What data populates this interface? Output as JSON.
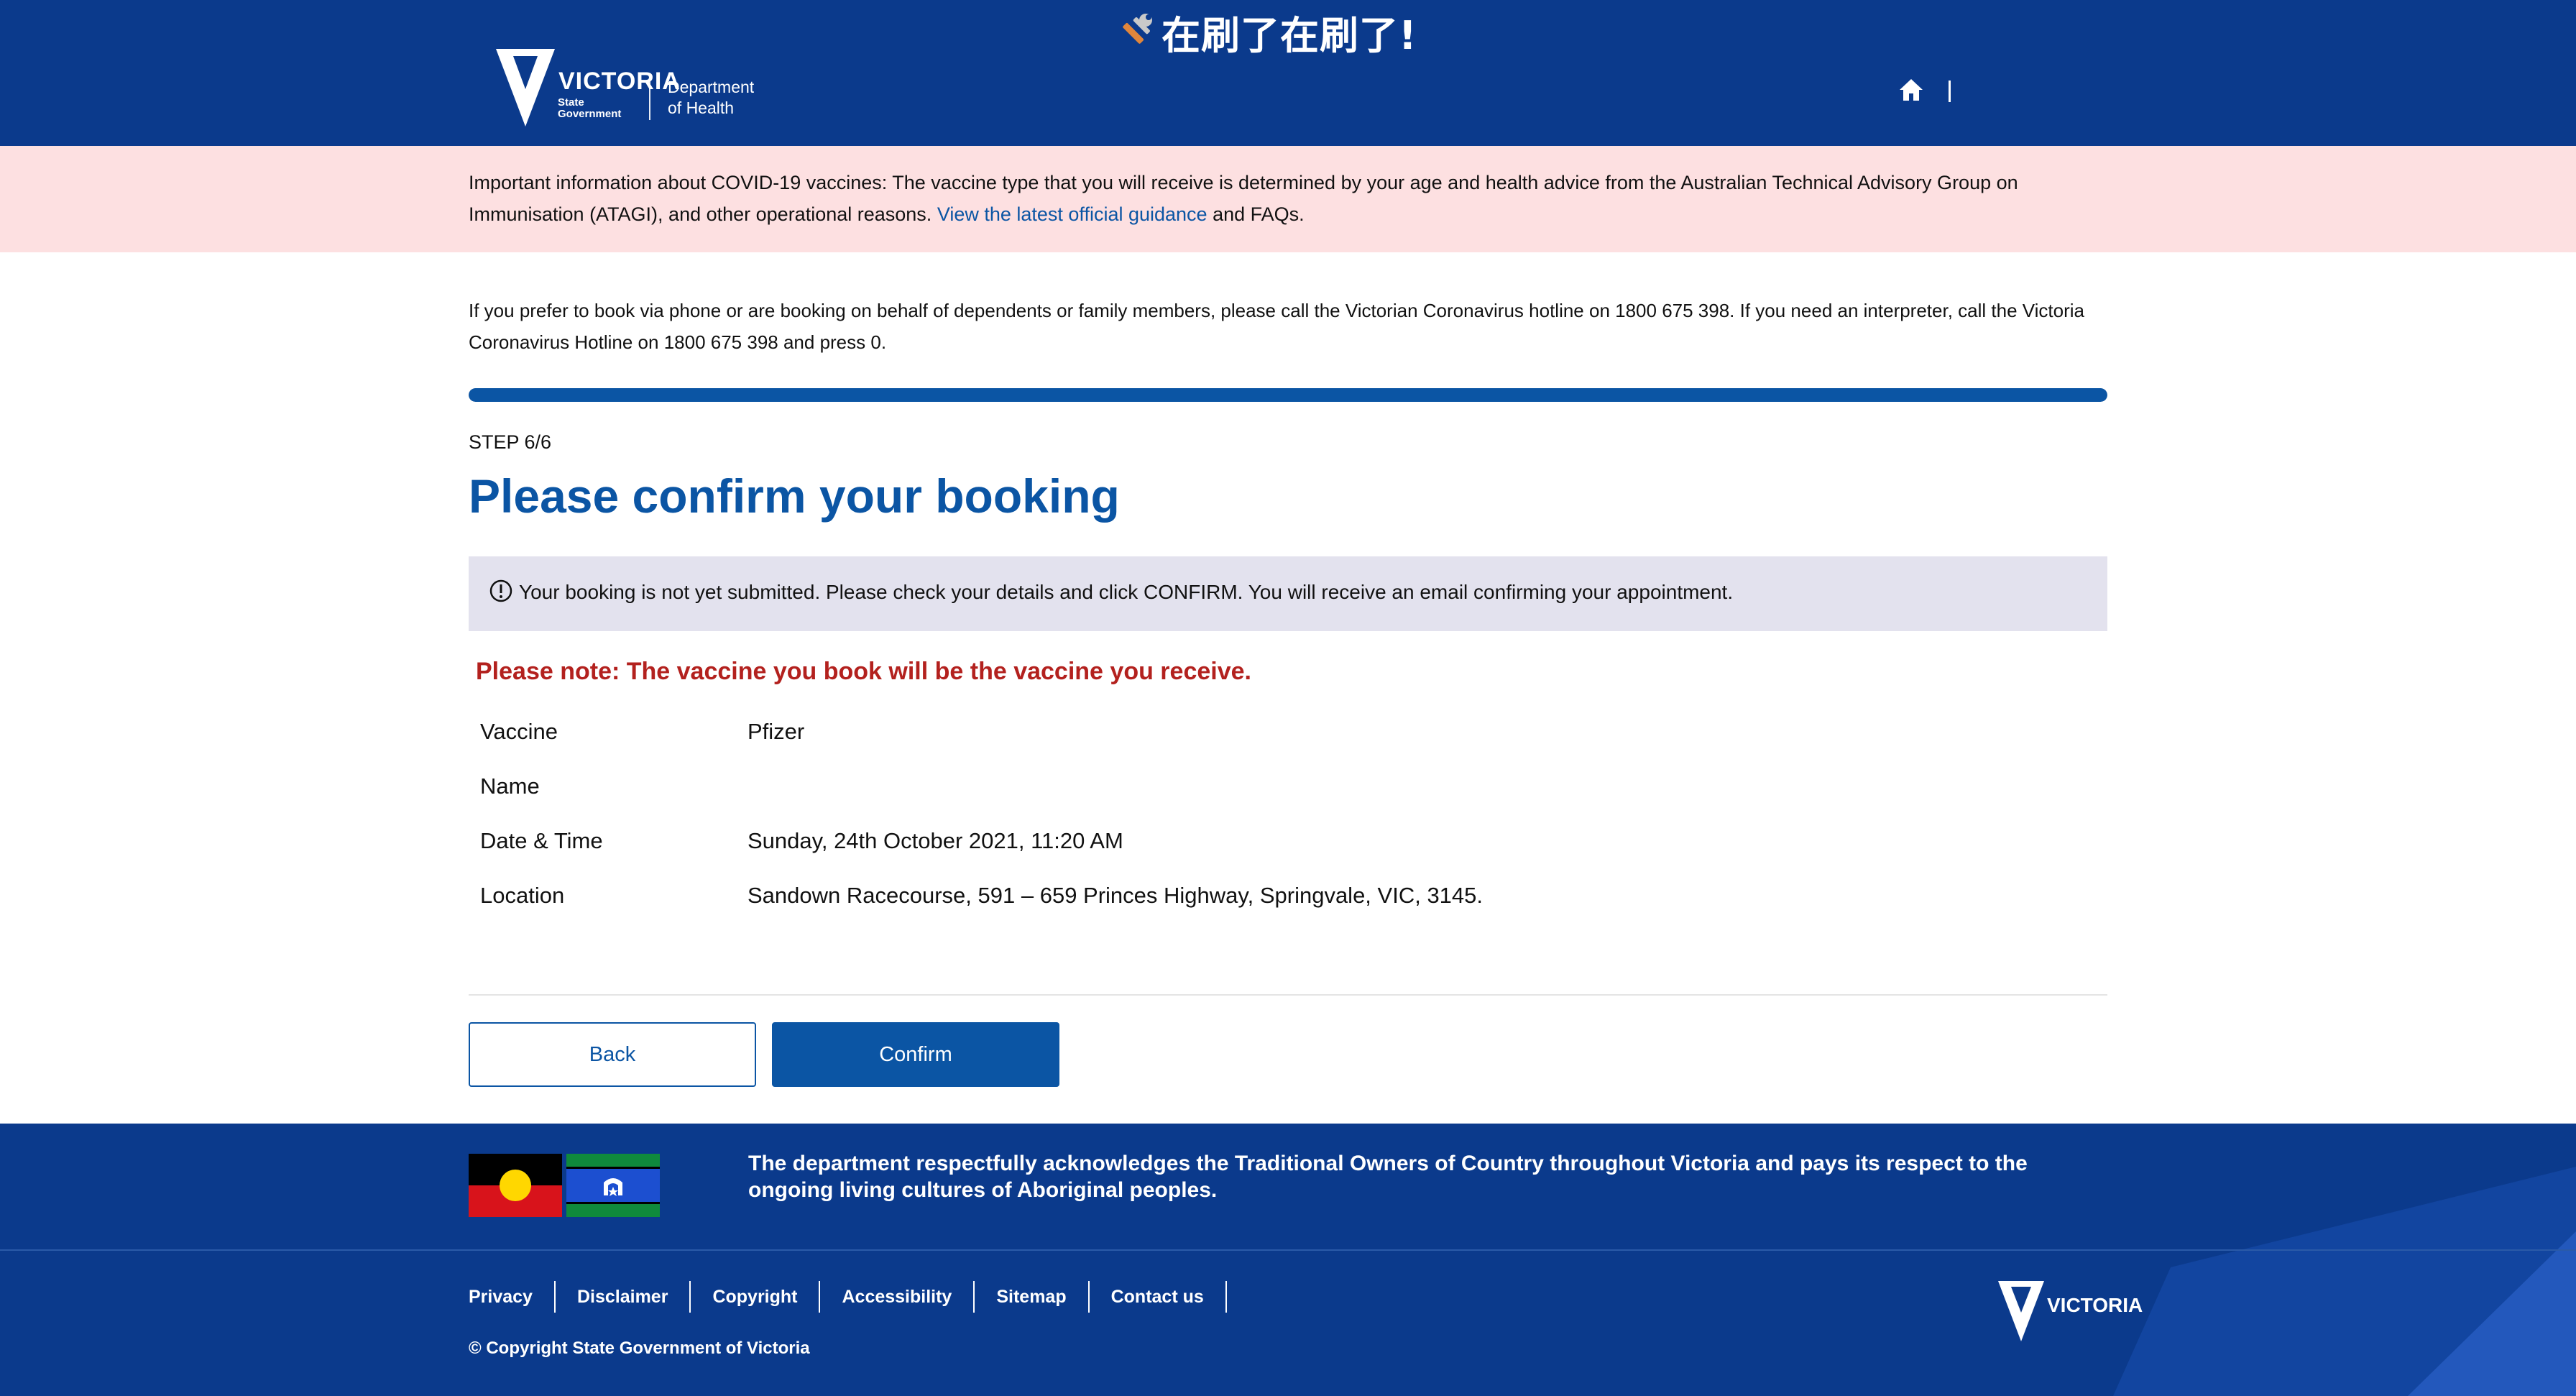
{
  "overlay": {
    "title": "在刷了在刷了!"
  },
  "header": {
    "logo_word": "VICTORIA",
    "logo_sub_line1": "State",
    "logo_sub_line2": "Government",
    "dept_line1": "Department",
    "dept_line2": "of Health",
    "icons": [
      "wrench-icon",
      "home-icon"
    ]
  },
  "alert": {
    "text": "Important information about COVID-19 vaccines: The vaccine type that you will receive is determined by your age and health advice from the Australian Technical Advisory Group on Immunisation (ATAGI), and other operational reasons. ",
    "link_text": "View the latest official guidance",
    "suffix": " and FAQs."
  },
  "intro": "If you prefer to book via phone or are booking on behalf of dependents or family members, please call the Victorian Coronavirus hotline on 1800 675 398. If you need an interpreter, call the Victoria Coronavirus Hotline on 1800 675 398 and press 0.",
  "progress": {
    "fraction": 1.0
  },
  "step": "STEP 6/6",
  "title": "Please confirm your booking",
  "info": "Your booking is not yet submitted. Please check your details and click CONFIRM. You will receive an email confirming your appointment.",
  "note": "Please note: The vaccine you book will be the vaccine you receive.",
  "details": [
    {
      "label": "Vaccine",
      "value": "Pfizer"
    },
    {
      "label": "Name",
      "value": ""
    },
    {
      "label": "Date & Time",
      "value": "Sunday, 24th October 2021, 11:20 AM"
    },
    {
      "label": "Location",
      "value": "Sandown Racecourse, 591 – 659 Princes Highway, Springvale, VIC, 3145."
    }
  ],
  "buttons": {
    "back": "Back",
    "confirm": "Confirm"
  },
  "footer": {
    "acknowledgement": "The department respectfully acknowledges the Traditional Owners of Country throughout Victoria and pays its respect to the ongoing living cultures of Aboriginal peoples.",
    "links": [
      "Privacy",
      "Disclaimer",
      "Copyright",
      "Accessibility",
      "Sitemap",
      "Contact us"
    ],
    "copyright": "© Copyright State Government of Victoria",
    "logo_word": "VICTORIA"
  },
  "colors": {
    "brand_navy": "#0b3a8c",
    "brand_blue": "#0b55a4",
    "alert_bg": "#fde0e1",
    "info_bg": "#e3e2ee",
    "note_red": "#b3211e"
  }
}
